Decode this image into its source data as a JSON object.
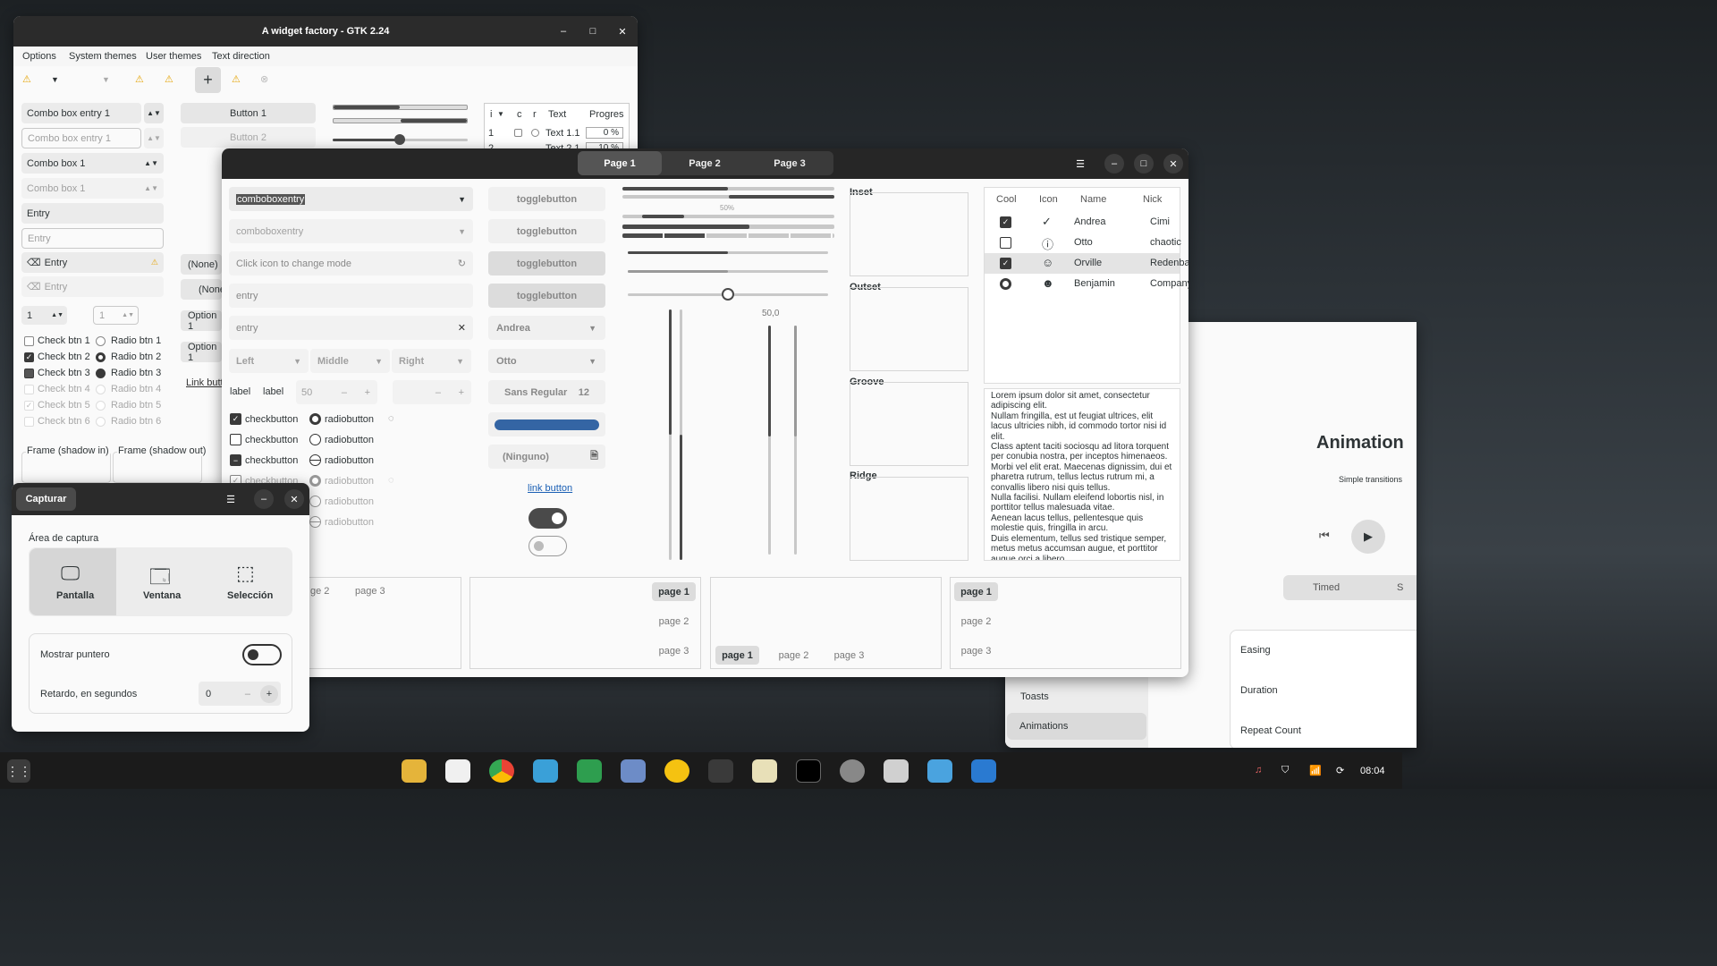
{
  "widget_factory": {
    "title": "A widget factory - GTK 2.24",
    "menu": [
      "Options",
      "System themes",
      "User themes",
      "Text direction"
    ],
    "combo_entry_1": "Combo box entry 1",
    "combo_entry_1_dim": "Combo box entry 1",
    "combo_box_1": "Combo box 1",
    "combo_box_1_dim": "Combo box 1",
    "entry": "Entry",
    "entry_placeholder": "Entry",
    "entry_icon": "Entry",
    "entry_icon_dim": "Entry",
    "spin_1": "1",
    "spin_1_dim": "1",
    "checks": [
      "Check btn 1",
      "Check btn 2",
      "Check btn 3",
      "Check btn 4",
      "Check btn 5",
      "Check btn 6"
    ],
    "radios": [
      "Radio btn 1",
      "Radio btn 2",
      "Radio btn 3",
      "Radio btn 4",
      "Radio btn 5",
      "Radio btn 6"
    ],
    "button_1": "Button 1",
    "button_2": "Button 2",
    "none_1": "(None)",
    "none_2": "(None",
    "option_1a": "Option 1",
    "option_1b": "Option 1",
    "link_button": "Link butto",
    "frame_in": "Frame (shadow in)",
    "frame_out": "Frame (shadow out)",
    "tree_headers": [
      "i",
      "c",
      "r",
      "Text",
      "Progres"
    ],
    "tree_rows": [
      {
        "i": "1",
        "text": "Text 1.1",
        "progress": "0 %"
      },
      {
        "i": "2",
        "text": "Text 2.1",
        "progress": "10 %"
      }
    ]
  },
  "gtk4": {
    "tabs": [
      "Page 1",
      "Page 2",
      "Page 3"
    ],
    "comboboxentry": "comboboxentry",
    "comboboxentry_dim": "comboboxentry",
    "mode_placeholder": "Click icon to change mode",
    "entry_ph_1": "entry",
    "entry_ph_2": "entry",
    "linked": [
      "Left",
      "Middle",
      "Right"
    ],
    "label_a": "label",
    "label_b": "label",
    "spin_50": "50",
    "checkbutton": "checkbutton",
    "radiobutton": "radiobutton",
    "togglebuttons": [
      "togglebutton",
      "togglebutton",
      "togglebutton",
      "togglebutton"
    ],
    "combo_andrea": "Andrea",
    "combo_otto": "Otto",
    "font": "Sans Regular",
    "font_size": "12",
    "file_none": "(Ninguno)",
    "link_button": "link button",
    "progress_label": "50%",
    "scale_value": "50,0",
    "frames": [
      "Inset",
      "Outset",
      "Groove",
      "Ridge"
    ],
    "list_headers": [
      "Cool",
      "Icon",
      "Name",
      "Nick"
    ],
    "list_rows": [
      {
        "name": "Andrea",
        "nick": "Cimi",
        "icon": "check-circle-icon"
      },
      {
        "name": "Otto",
        "nick": "chaotic",
        "icon": "warning-circle-icon"
      },
      {
        "name": "Orville",
        "nick": "Redenba...",
        "icon": "face-icon"
      },
      {
        "name": "Benjamin",
        "nick": "Company",
        "icon": "robot-icon"
      }
    ],
    "lorem": "Lorem ipsum dolor sit amet, consectetur adipiscing elit.\nNullam fringilla, est ut feugiat ultrices, elit lacus ultricies nibh, id commodo tortor nisi id elit.\nClass aptent taciti sociosqu ad litora torquent per conubia nostra, per inceptos himenaeos.\nMorbi vel elit erat. Maecenas dignissim, dui et pharetra rutrum, tellus lectus rutrum mi, a convallis libero nisi quis tellus.\nNulla facilisi. Nullam eleifend lobortis nisl, in porttitor tellus malesuada vitae.\nAenean lacus tellus, pellentesque quis molestie quis, fringilla in arcu.\nDuis elementum, tellus sed tristique semper, metus metus accumsan augue, et porttitor augue orci a libero.",
    "nb_tabs": [
      "page 1",
      "page 2",
      "page 3"
    ],
    "nb_partial": "ge 2"
  },
  "capture": {
    "title": "Capturar",
    "area_label": "Área de captura",
    "modes": [
      "Pantalla",
      "Ventana",
      "Selección"
    ],
    "pointer_label": "Mostrar puntero",
    "delay_label": "Retardo, en segundos",
    "delay_value": "0"
  },
  "demo": {
    "heading": "Animation",
    "subtitle": "Simple transitions",
    "tab_timed": "Timed",
    "tab_s": "S",
    "rows": [
      "Easing",
      "Duration",
      "Repeat Count"
    ],
    "sidebar": [
      "Toasts",
      "Animations"
    ]
  },
  "taskbar": {
    "clock": "08:04"
  }
}
